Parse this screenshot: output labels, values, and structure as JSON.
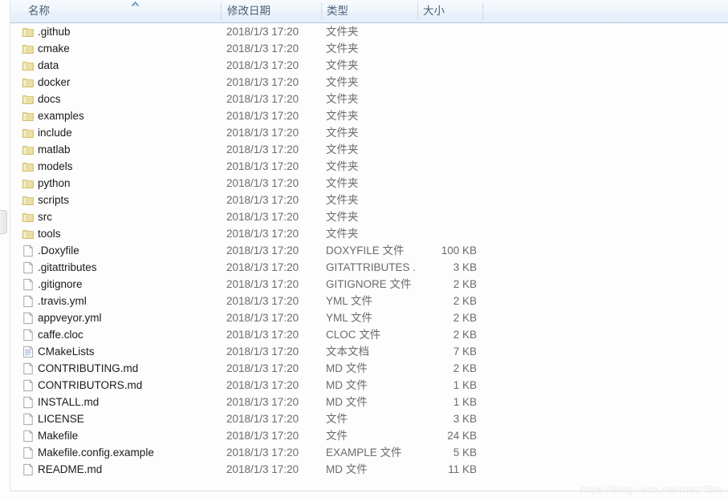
{
  "window": {
    "kind": "file-explorer-list-view"
  },
  "columns": [
    {
      "key": "name",
      "label": "名称",
      "sorted": true,
      "sort_direction": "ascending"
    },
    {
      "key": "date",
      "label": "修改日期",
      "sorted": false,
      "sort_direction": ""
    },
    {
      "key": "type",
      "label": "类型",
      "sorted": false,
      "sort_direction": ""
    },
    {
      "key": "size",
      "label": "大小",
      "sorted": false,
      "sort_direction": ""
    }
  ],
  "files": [
    {
      "name": ".github",
      "date": "2018/1/3 17:20",
      "type": "文件夹",
      "size": "",
      "icon": "folder-icon"
    },
    {
      "name": "cmake",
      "date": "2018/1/3 17:20",
      "type": "文件夹",
      "size": "",
      "icon": "folder-icon"
    },
    {
      "name": "data",
      "date": "2018/1/3 17:20",
      "type": "文件夹",
      "size": "",
      "icon": "folder-icon"
    },
    {
      "name": "docker",
      "date": "2018/1/3 17:20",
      "type": "文件夹",
      "size": "",
      "icon": "folder-icon"
    },
    {
      "name": "docs",
      "date": "2018/1/3 17:20",
      "type": "文件夹",
      "size": "",
      "icon": "folder-icon"
    },
    {
      "name": "examples",
      "date": "2018/1/3 17:20",
      "type": "文件夹",
      "size": "",
      "icon": "folder-icon"
    },
    {
      "name": "include",
      "date": "2018/1/3 17:20",
      "type": "文件夹",
      "size": "",
      "icon": "folder-icon"
    },
    {
      "name": "matlab",
      "date": "2018/1/3 17:20",
      "type": "文件夹",
      "size": "",
      "icon": "folder-icon"
    },
    {
      "name": "models",
      "date": "2018/1/3 17:20",
      "type": "文件夹",
      "size": "",
      "icon": "folder-icon"
    },
    {
      "name": "python",
      "date": "2018/1/3 17:20",
      "type": "文件夹",
      "size": "",
      "icon": "folder-icon"
    },
    {
      "name": "scripts",
      "date": "2018/1/3 17:20",
      "type": "文件夹",
      "size": "",
      "icon": "folder-icon"
    },
    {
      "name": "src",
      "date": "2018/1/3 17:20",
      "type": "文件夹",
      "size": "",
      "icon": "folder-icon"
    },
    {
      "name": "tools",
      "date": "2018/1/3 17:20",
      "type": "文件夹",
      "size": "",
      "icon": "folder-icon"
    },
    {
      "name": ".Doxyfile",
      "date": "2018/1/3 17:20",
      "type": "DOXYFILE 文件",
      "size": "100 KB",
      "icon": "generic-file-icon"
    },
    {
      "name": ".gitattributes",
      "date": "2018/1/3 17:20",
      "type": "GITATTRIBUTES ...",
      "size": "3 KB",
      "icon": "generic-file-icon"
    },
    {
      "name": ".gitignore",
      "date": "2018/1/3 17:20",
      "type": "GITIGNORE 文件",
      "size": "2 KB",
      "icon": "generic-file-icon"
    },
    {
      "name": ".travis.yml",
      "date": "2018/1/3 17:20",
      "type": "YML 文件",
      "size": "2 KB",
      "icon": "generic-file-icon"
    },
    {
      "name": "appveyor.yml",
      "date": "2018/1/3 17:20",
      "type": "YML 文件",
      "size": "2 KB",
      "icon": "generic-file-icon"
    },
    {
      "name": "caffe.cloc",
      "date": "2018/1/3 17:20",
      "type": "CLOC 文件",
      "size": "2 KB",
      "icon": "generic-file-icon"
    },
    {
      "name": "CMakeLists",
      "date": "2018/1/3 17:20",
      "type": "文本文档",
      "size": "7 KB",
      "icon": "text-document-icon"
    },
    {
      "name": "CONTRIBUTING.md",
      "date": "2018/1/3 17:20",
      "type": "MD 文件",
      "size": "2 KB",
      "icon": "generic-file-icon"
    },
    {
      "name": "CONTRIBUTORS.md",
      "date": "2018/1/3 17:20",
      "type": "MD 文件",
      "size": "1 KB",
      "icon": "generic-file-icon"
    },
    {
      "name": "INSTALL.md",
      "date": "2018/1/3 17:20",
      "type": "MD 文件",
      "size": "1 KB",
      "icon": "generic-file-icon"
    },
    {
      "name": "LICENSE",
      "date": "2018/1/3 17:20",
      "type": "文件",
      "size": "3 KB",
      "icon": "generic-file-icon"
    },
    {
      "name": "Makefile",
      "date": "2018/1/3 17:20",
      "type": "文件",
      "size": "24 KB",
      "icon": "generic-file-icon"
    },
    {
      "name": "Makefile.config.example",
      "date": "2018/1/3 17:20",
      "type": "EXAMPLE 文件",
      "size": "5 KB",
      "icon": "generic-file-icon"
    },
    {
      "name": "README.md",
      "date": "2018/1/3 17:20",
      "type": "MD 文件",
      "size": "11 KB",
      "icon": "generic-file-icon"
    }
  ],
  "watermark": {
    "text": "https://blog.csdn.net/matt45m"
  },
  "colors": {
    "header_border": "#b5c8dd",
    "header_text": "#4a6076",
    "name_text": "#1b1b1b",
    "meta_text": "#6b6b6b",
    "folder_icon": "#ead98a",
    "sort_caret": "#3f6fa8",
    "watermark": "#ececec"
  }
}
